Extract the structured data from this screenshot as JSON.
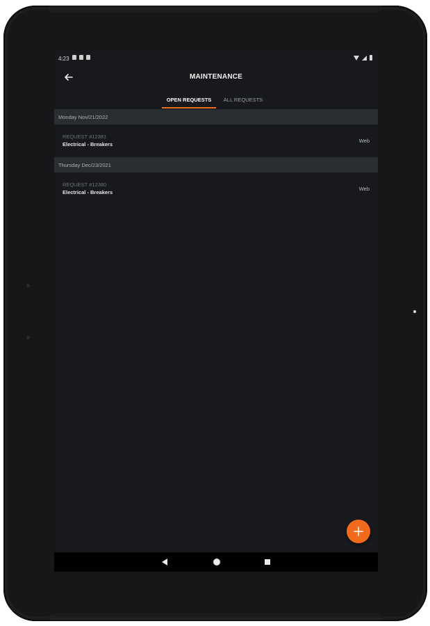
{
  "status_bar": {
    "time": "4:23",
    "left_icons": [
      "message-icon",
      "notification-icon",
      "sim-icon"
    ],
    "right_icons": [
      "wifi-icon",
      "signal-icon",
      "battery-icon"
    ]
  },
  "app_bar": {
    "title": "MAINTENANCE",
    "back_icon": "arrow-left-icon"
  },
  "tabs": [
    {
      "label": "OPEN REQUESTS",
      "active": true
    },
    {
      "label": "ALL REQUESTS",
      "active": false
    }
  ],
  "sections": [
    {
      "date": "Monday Nov/21/2022",
      "requests": [
        {
          "id": "REQUEST #12381",
          "category": "Electrical - Breakers",
          "source": "Web"
        }
      ]
    },
    {
      "date": "Thursday Dec/23/2021",
      "requests": [
        {
          "id": "REQUEST #12380",
          "category": "Electrical - Breakers",
          "source": "Web"
        }
      ]
    }
  ],
  "fab": {
    "icon": "plus-icon"
  },
  "colors": {
    "accent": "#f26b1d",
    "background": "#17191c",
    "section_header": "#2a2d31"
  },
  "nav_bar": {
    "icons": [
      "nav-back-icon",
      "nav-home-icon",
      "nav-recents-icon"
    ]
  }
}
